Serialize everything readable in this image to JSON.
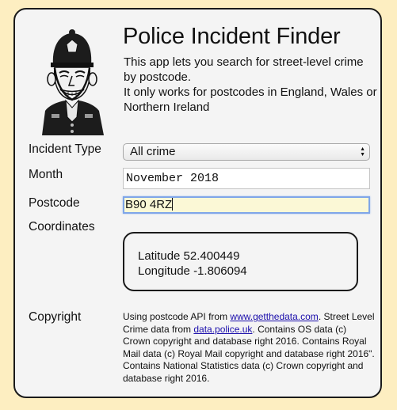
{
  "header": {
    "title": "Police Incident Finder",
    "description_lines": [
      "This app lets you search for street-level crime by postcode.",
      "It only works for postcodes in England, Wales or Northern Ireland"
    ]
  },
  "form": {
    "incident_type_label": "Incident Type",
    "incident_type_value": "All crime",
    "month_label": "Month",
    "month_value": "November 2018",
    "postcode_label": "Postcode",
    "postcode_value": "B90 4RZ",
    "coordinates_label": "Coordinates",
    "latitude_text": "Latitude 52.400449",
    "longitude_text": "Longitude -1.806094"
  },
  "copyright": {
    "label": "Copyright",
    "text_part1": "Using postcode API from ",
    "link1": "www.getthedata.com",
    "text_part2": ". Street Level Crime data from ",
    "link2": "data.police.uk",
    "text_part3": ". Contains OS data (c) Crown copyright and database right 2016. Contains Royal Mail data (c) Royal Mail copyright and database right 2016\". Contains National Statistics data (c) Crown copyright and database right 2016."
  },
  "colors": {
    "page_background": "#fdeec1",
    "card_background": "#f4f4f4",
    "link": "#1a0dab",
    "postcode_focus_border": "#7fa6e8"
  },
  "icons": {
    "logo": "police-officer-cartoon",
    "select_arrows": "updown-chevron-icon"
  }
}
